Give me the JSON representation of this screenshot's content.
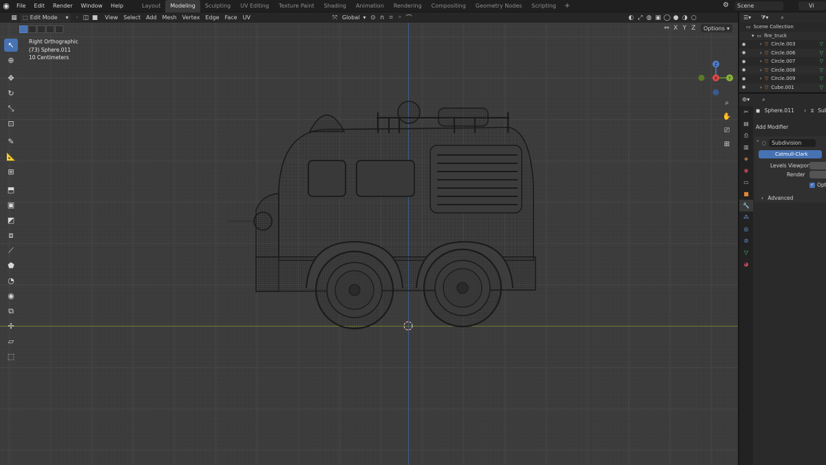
{
  "menu": [
    "File",
    "Edit",
    "Render",
    "Window",
    "Help"
  ],
  "workspaces": [
    "Layout",
    "Modeling",
    "Sculpting",
    "UV Editing",
    "Texture Paint",
    "Shading",
    "Animation",
    "Rendering",
    "Compositing",
    "Geometry Nodes",
    "Scripting"
  ],
  "active_workspace": "Modeling",
  "scene": "Scene",
  "view_layer": "Vi",
  "viewport_header": {
    "mode": "Edit Mode",
    "menu": [
      "View",
      "Select",
      "Add",
      "Mesh",
      "Vertex",
      "Edge",
      "Face",
      "UV"
    ],
    "orientation": "Global",
    "axes": [
      "X",
      "Y",
      "Z"
    ],
    "options": "Options"
  },
  "overlay": {
    "view": "Right Orthographic",
    "object": "(73) Sphere.011",
    "scale": "10 Centimeters"
  },
  "gizmo": {
    "x": "X",
    "y": "Y",
    "z": "Z"
  },
  "outliner": {
    "collection": "Scene Collection",
    "root": "fire_truck",
    "items": [
      "Circle.003",
      "Circle.006",
      "Circle.007",
      "Circle.008",
      "Circle.009",
      "Cube.001"
    ]
  },
  "properties": {
    "object": "Sphere.011",
    "object_trail": "Subd",
    "add_modifier": "Add Modifier",
    "modifier_name": "Subdivision",
    "algorithm": "Catmull-Clark",
    "levels_viewport_label": "Levels Viewport",
    "render_label": "Render",
    "optimal_label": "Optin",
    "advanced_label": "Advanced"
  },
  "colors": {
    "accent": "#4772b3",
    "viewport_bg": "#3d3d3d",
    "axis_x": "#6a7d2f",
    "axis_z": "#3e5f8f"
  }
}
